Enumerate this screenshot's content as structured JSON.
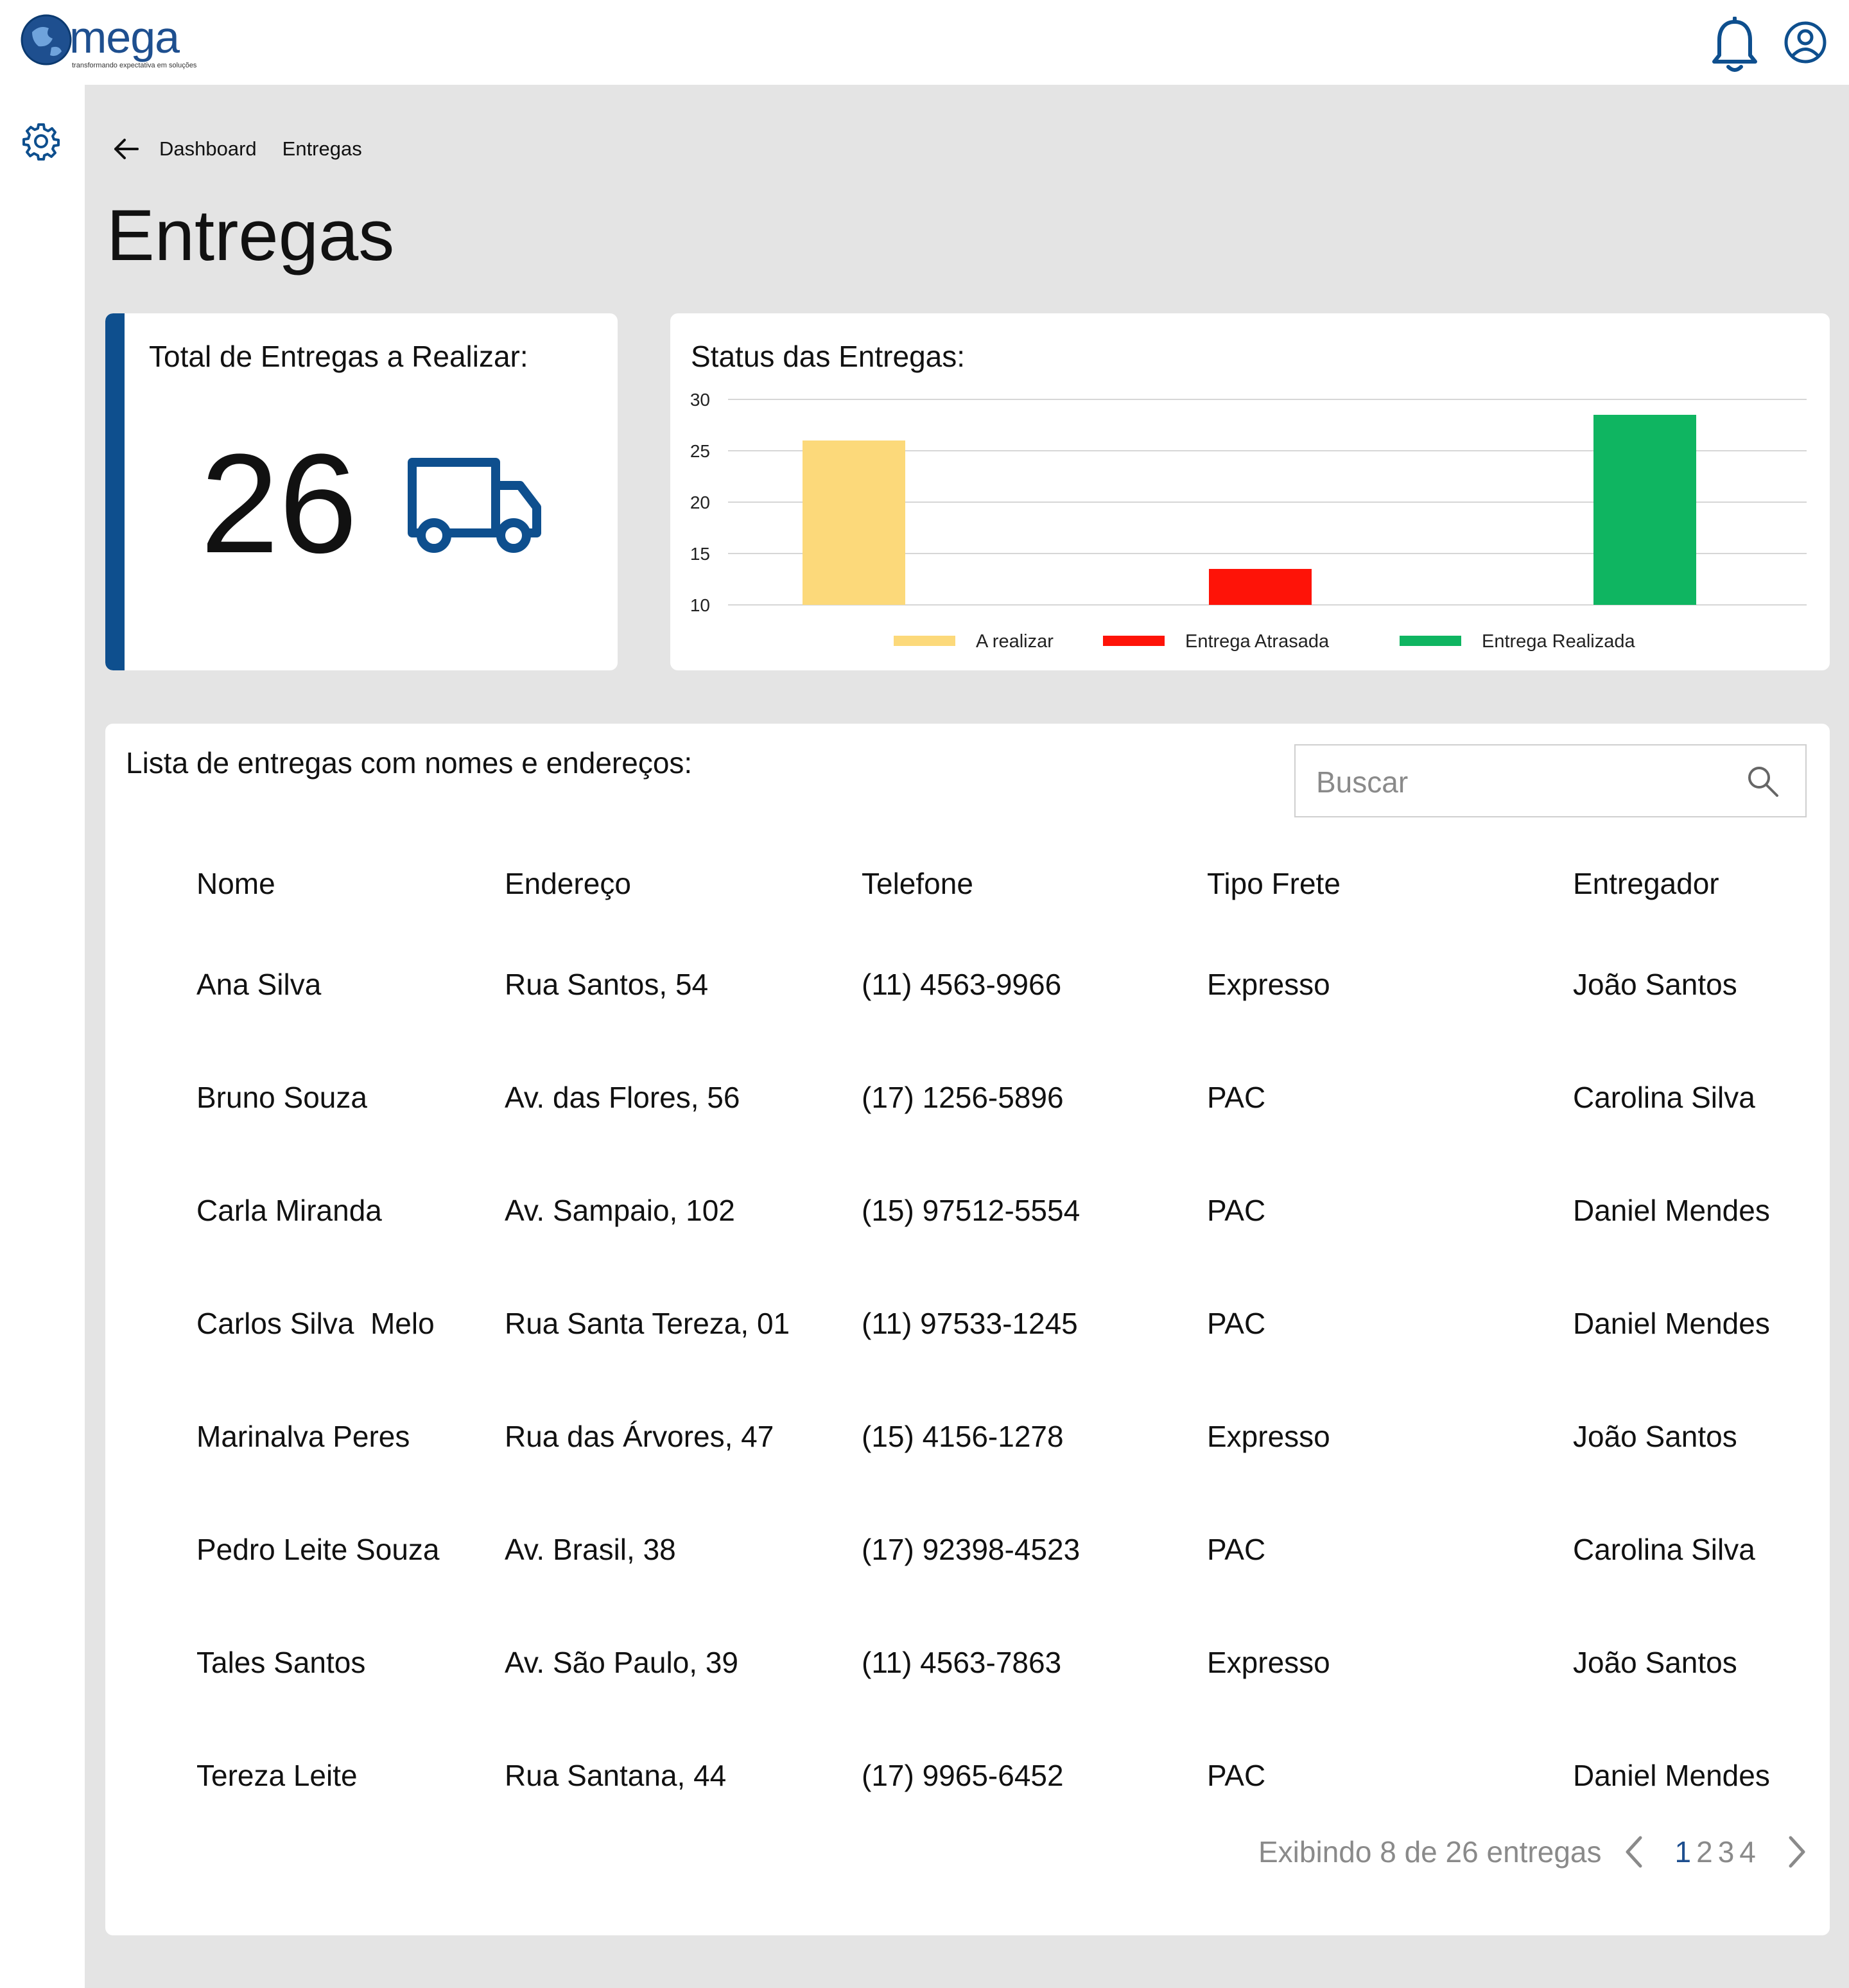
{
  "header": {
    "logo_text": "mega",
    "logo_tagline": "transformando expectativa em soluções",
    "icons": [
      "notification-bell-icon",
      "user-account-icon"
    ]
  },
  "sidebar": {
    "icons": [
      "settings-gear-icon"
    ]
  },
  "breadcrumb": {
    "back_icon": "arrow-left-icon",
    "items": [
      "Dashboard",
      "Entregas"
    ]
  },
  "page": {
    "title": "Entregas"
  },
  "summary_card": {
    "label": "Total de Entregas a Realizar:",
    "value": "26",
    "icon": "truck-icon",
    "accent_color": "#0e4f8e"
  },
  "status_card": {
    "label": "Status das Entregas:"
  },
  "chart_data": {
    "type": "bar",
    "title": "Status das Entregas:",
    "categories": [
      "A realizar",
      "Entrega Atrasada",
      "Entrega Realizada"
    ],
    "values": [
      26,
      13.5,
      28.5
    ],
    "colors": [
      "#fcd97a",
      "#fe1308",
      "#0fb561"
    ],
    "ylim": [
      10,
      30
    ],
    "yticks": [
      30,
      25,
      20,
      15,
      10
    ],
    "grid": true,
    "legend": "bottom"
  },
  "list_card": {
    "label": "Lista de entregas com nomes e endereços:",
    "search": {
      "placeholder": "Buscar",
      "icon": "search-icon"
    },
    "columns": [
      "Nome",
      "Endereço",
      "Telefone",
      "Tipo Frete",
      "Entregador"
    ],
    "rows": [
      [
        "Ana Silva",
        "Rua Santos, 54",
        "(11) 4563-9966",
        "Expresso",
        "João Santos"
      ],
      [
        "Bruno Souza",
        "Av. das Flores, 56",
        "(17) 1256-5896",
        "PAC",
        "Carolina Silva"
      ],
      [
        "Carla Miranda",
        "Av. Sampaio, 102",
        "(15) 97512-5554",
        "PAC",
        "Daniel Mendes"
      ],
      [
        "Carlos Silva  Melo",
        "Rua Santa Tereza, 01",
        "(11) 97533-1245",
        "PAC",
        "Daniel Mendes"
      ],
      [
        "Marinalva Peres",
        "Rua das Árvores, 47",
        "(15) 4156-1278",
        "Expresso",
        "João Santos"
      ],
      [
        "Pedro Leite Souza",
        "Av. Brasil, 38",
        "(17) 92398-4523",
        "PAC",
        "Carolina Silva"
      ],
      [
        "Tales Santos",
        "Av. São Paulo, 39",
        "(11) 4563-7863",
        "Expresso",
        "João Santos"
      ],
      [
        "Tereza Leite",
        "Rua Santana, 44",
        "(17) 9965-6452",
        "PAC",
        "Daniel Mendes"
      ]
    ],
    "pagination": {
      "info": "Exibindo 8 de 26 entregas",
      "pages": [
        "1",
        "2",
        "3",
        "4"
      ],
      "current": "1",
      "prev_icon": "chevron-left-icon",
      "next_icon": "chevron-right-icon"
    }
  },
  "colors": {
    "brand": "#1e4f8f",
    "background": "#e4e4e4"
  }
}
